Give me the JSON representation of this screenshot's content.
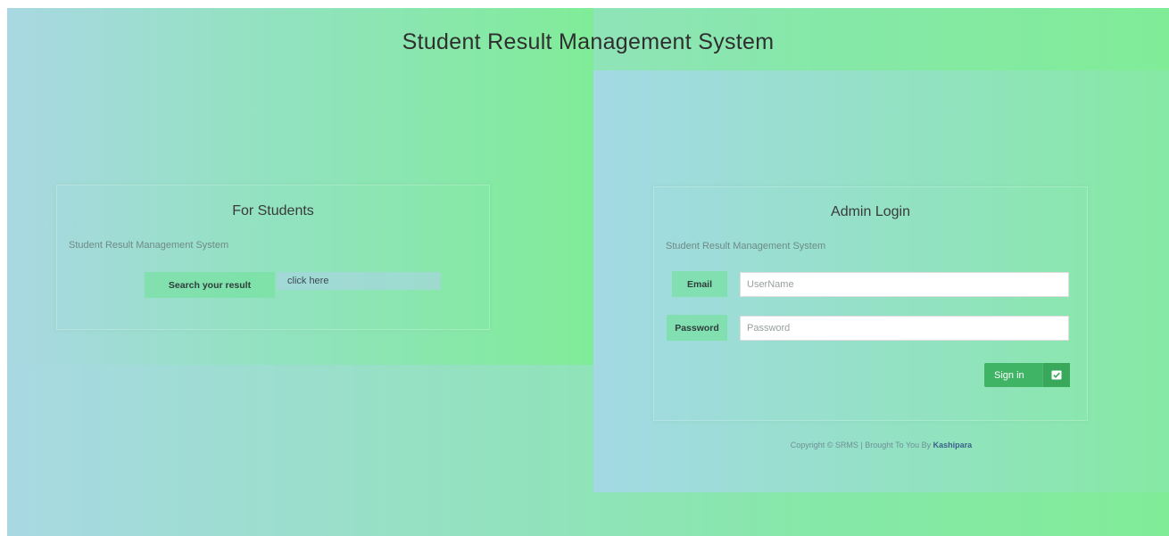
{
  "page": {
    "title": "Student Result Management System"
  },
  "student_card": {
    "title": "For Students",
    "subtitle": "Student Result Management System",
    "search_label": "Search your result",
    "link_label": "click here"
  },
  "admin_card": {
    "title": "Admin Login",
    "subtitle": "Student Result Management System",
    "email_label": "Email",
    "email_placeholder": "UserName",
    "password_label": "Password",
    "password_placeholder": "Password",
    "signin_label": "Sign in",
    "signin_icon": "checkbox-icon"
  },
  "footer": {
    "copyright_text": "Copyright © SRMS | Brought To You By ",
    "brand": "Kashipara"
  },
  "colors": {
    "accent_green": "#3fb464",
    "gradient_left": "#a8d9e3",
    "gradient_right": "#80ec98"
  }
}
